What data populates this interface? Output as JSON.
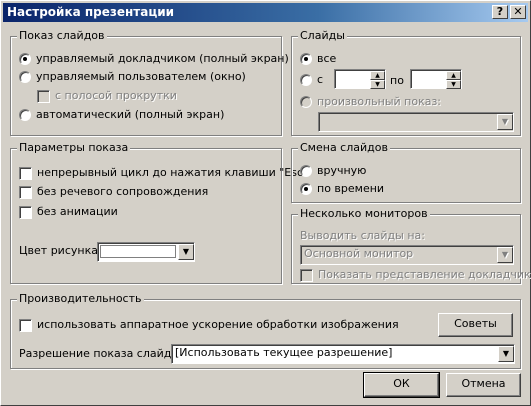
{
  "window": {
    "title": "Настройка презентации",
    "help_glyph": "?",
    "close_glyph": "✕"
  },
  "show_type": {
    "legend": "Показ слайдов",
    "options": [
      {
        "label": "управляемый докладчиком (полный экран)",
        "checked": true,
        "enabled": true
      },
      {
        "label": "управляемый пользователем (окно)",
        "checked": false,
        "enabled": true
      },
      {
        "label": "автоматический (полный экран)",
        "checked": false,
        "enabled": true
      }
    ],
    "scrollbar_check": {
      "label": "с полосой прокрутки",
      "checked": false,
      "enabled": false
    }
  },
  "slides": {
    "legend": "Слайды",
    "all_label": "все",
    "from_label": "с",
    "from_value": "",
    "to_label": "по",
    "to_value": "",
    "custom_label": "произвольный показ:",
    "custom_value": ""
  },
  "options": {
    "legend": "Параметры показа",
    "checks": [
      {
        "label": "непрерывный цикл до нажатия клавиши \"Esc\"",
        "checked": false
      },
      {
        "label": "без речевого сопровождения",
        "checked": false
      },
      {
        "label": "без анимации",
        "checked": false
      }
    ],
    "pen_color_label": "Цвет рисунка:",
    "pen_color": "#ffffff"
  },
  "advance": {
    "legend": "Смена слайдов",
    "manual_label": "вручную",
    "timings_label": "по времени",
    "selected": "timings"
  },
  "monitors": {
    "legend": "Несколько мониторов",
    "display_on_label": "Выводить слайды на:",
    "display_on_value": "Основной монитор",
    "presenter_view_label": "Показать представление докладчика"
  },
  "performance": {
    "legend": "Производительность",
    "hw_accel_label": "использовать аппаратное ускорение обработки изображения",
    "tips_label": "Советы",
    "resolution_label": "Разрешение показа слайдов:",
    "resolution_value": "[Использовать текущее разрешение]"
  },
  "footer": {
    "ok_label": "ОК",
    "cancel_label": "Отмена"
  },
  "colors": {
    "dialog_bg": "#d4d0c8",
    "title_start": "#0a246a",
    "title_end": "#a6caf0"
  }
}
